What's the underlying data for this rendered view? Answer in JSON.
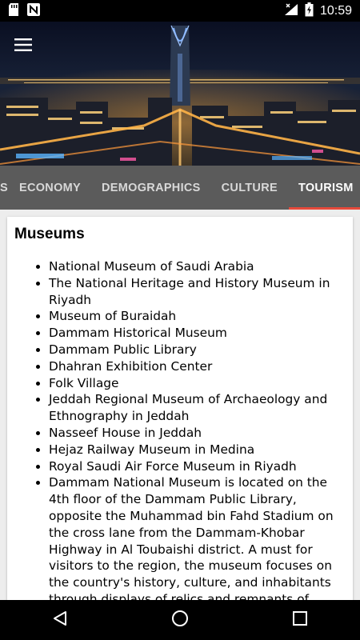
{
  "status_bar": {
    "time": "10:59",
    "icons": [
      "sd-card-icon",
      "n-notification-icon",
      "signal-icon",
      "battery-charging-icon"
    ]
  },
  "header": {
    "menu_icon": "hamburger-menu-icon",
    "image": "riyadh-skyline-night"
  },
  "tabs": [
    {
      "label": "S",
      "active": false
    },
    {
      "label": "ECONOMY",
      "active": false
    },
    {
      "label": "DEMOGRAPHICS",
      "active": false
    },
    {
      "label": "CULTURE",
      "active": false
    },
    {
      "label": "TOURISM",
      "active": true
    }
  ],
  "colors": {
    "tab_bar": "#5b5b5b",
    "tab_indicator": "#e64a3b",
    "background": "#ededed"
  },
  "content": {
    "title": "Museums",
    "items": [
      "National Museum of Saudi Arabia",
      "The National Heritage and History Museum in Riyadh",
      "Museum of Buraidah",
      "Dammam Historical Museum",
      "Dammam Public Library",
      "Dhahran Exhibition Center",
      "Folk Village",
      "Jeddah Regional Museum of Archaeology and Ethnography in Jeddah",
      "Nasseef House in Jeddah",
      "Hejaz Railway Museum in Medina",
      "Royal Saudi Air Force Museum in Riyadh",
      "Dammam National Museum is located on the 4th floor of the Dammam Public Library, opposite the Muhammad bin Fahd Stadium on the cross lane from the Dammam-Khobar Highway in Al Toubaishi district. A must for visitors to the region, the museum focuses on the country's history, culture, and inhabitants through displays of relics and remnants of"
    ]
  },
  "nav_bar": {
    "buttons": [
      "back-icon",
      "home-icon",
      "recents-icon"
    ]
  }
}
